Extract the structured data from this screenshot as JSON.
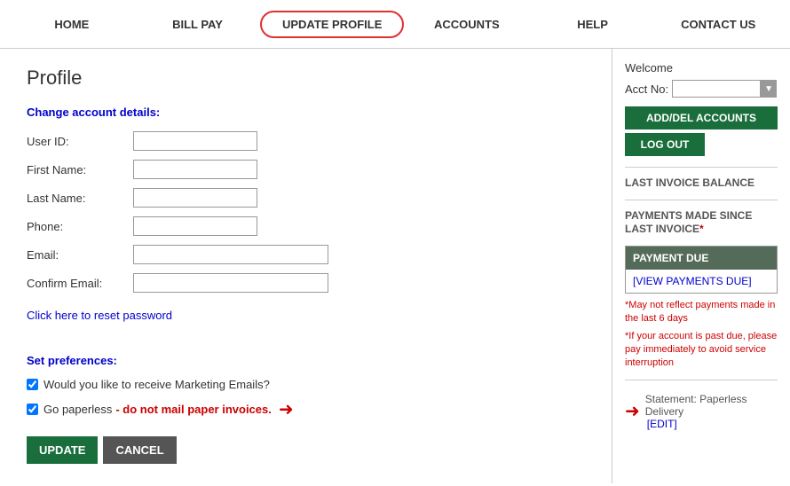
{
  "nav": {
    "items": [
      {
        "id": "home",
        "label": "HOME",
        "active": false
      },
      {
        "id": "bill-pay",
        "label": "BILL PAY",
        "active": false
      },
      {
        "id": "update-profile",
        "label": "UPDATE PROFILE",
        "active": true
      },
      {
        "id": "accounts",
        "label": "ACCOUNTS",
        "active": false
      },
      {
        "id": "help",
        "label": "HELP",
        "active": false
      },
      {
        "id": "contact-us",
        "label": "CONTACT US",
        "active": false
      }
    ]
  },
  "profile": {
    "title": "Profile",
    "change_heading": "Change account details:",
    "fields": {
      "user_id_label": "User ID:",
      "first_name_label": "First Name:",
      "last_name_label": "Last Name:",
      "phone_label": "Phone:",
      "email_label": "Email:",
      "confirm_email_label": "Confirm Email:"
    },
    "reset_link": "Click here to reset password",
    "prefs_heading": "Set preferences:",
    "marketing_label": "Would you like to receive Marketing Emails?",
    "paperless_label": "Go paperless",
    "paperless_note": "- do not mail paper invoices.",
    "update_btn": "UPDATE",
    "cancel_btn": "CANCEL"
  },
  "sidebar": {
    "welcome": "Welcome",
    "acct_label": "Acct No:",
    "add_del_btn": "ADD/DEL ACCOUNTS",
    "logout_btn": "LOG OUT",
    "last_invoice_label": "LAST INVOICE BALANCE",
    "payments_label": "PAYMENTS MADE SINCE LAST INVOICE",
    "payments_asterisk": "*",
    "payment_due_header": "PAYMENT DUE",
    "view_payments_link": "[VIEW PAYMENTS DUE]",
    "note1": "*May not reflect payments made in the last 6 days",
    "note2": "*If your account is past due, please pay immediately to avoid service interruption",
    "statement_text": "Statement: Paperless Delivery",
    "edit_link": "[EDIT]"
  },
  "arrows": {
    "right": "→",
    "right2": "→"
  }
}
